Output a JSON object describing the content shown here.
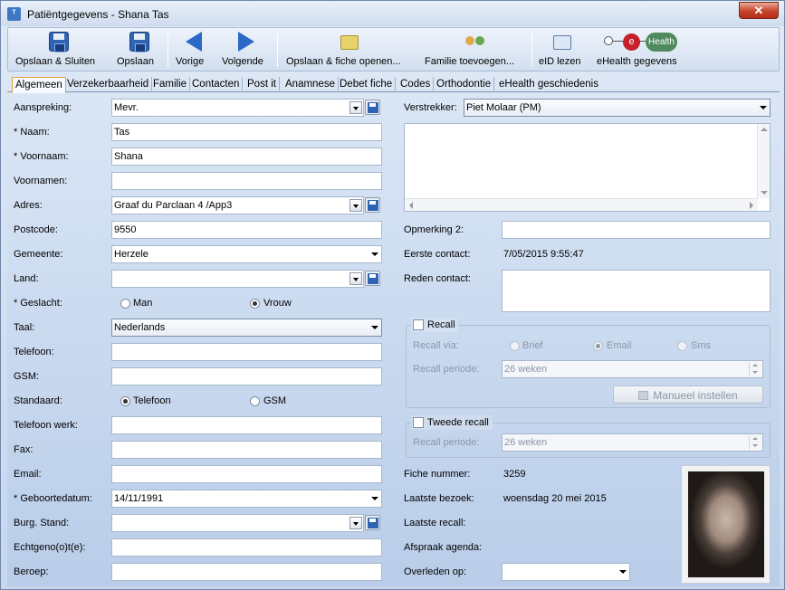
{
  "window": {
    "title": "Patiëntgegevens - Shana Tas",
    "close_label": "✕"
  },
  "toolbar": {
    "save_close": "Opslaan & Sluiten",
    "save": "Opslaan",
    "prev": "Vorige",
    "next": "Volgende",
    "save_open": "Opslaan & fiche openen...",
    "add_family": "Familie toevoegen...",
    "eid": "eID lezen",
    "ehealth": "eHealth gegevens",
    "ehealth_logo_e": "e",
    "ehealth_logo_text": "Health"
  },
  "tabs": [
    "Algemeen",
    "Verzekerbaarheid",
    "Familie",
    "Contacten",
    "Post it",
    "Anamnese",
    "Debet fiche",
    "Codes",
    "Orthodontie",
    "eHealth geschiedenis"
  ],
  "form": {
    "aanspreking_label": "Aanspreking:",
    "aanspreking_value": "Mevr.",
    "naam_label": "* Naam:",
    "naam_value": "Tas",
    "voornaam_label": "* Voornaam:",
    "voornaam_value": "Shana",
    "voornamen_label": "Voornamen:",
    "voornamen_value": "",
    "adres_label": "Adres:",
    "adres_value": "Graaf du Parclaan 4 /App3",
    "postcode_label": "Postcode:",
    "postcode_value": "9550",
    "gemeente_label": "Gemeente:",
    "gemeente_value": "Herzele",
    "land_label": "Land:",
    "land_value": "",
    "geslacht_label": "* Geslacht:",
    "geslacht_man": "Man",
    "geslacht_vrouw": "Vrouw",
    "taal_label": "Taal:",
    "taal_value": "Nederlands",
    "telefoon_label": "Telefoon:",
    "gsm_label": "GSM:",
    "standaard_label": "Standaard:",
    "standaard_telefoon": "Telefoon",
    "standaard_gsm": "GSM",
    "telefoon_werk_label": "Telefoon werk:",
    "fax_label": "Fax:",
    "email_label": "Email:",
    "geboortedatum_label": "* Geboortedatum:",
    "geboortedatum_value": "14/11/1991",
    "burg_stand_label": "Burg. Stand:",
    "echtgenote_label": "Echtgeno(o)t(e):",
    "beroep_label": "Beroep:"
  },
  "right": {
    "verstrekker_label": "Verstrekker:",
    "verstrekker_value": "Piet Molaar (PM)",
    "opmerking2_label": "Opmerking 2:",
    "eerste_contact_label": "Eerste contact:",
    "eerste_contact_value": "7/05/2015 9:55:47",
    "reden_contact_label": "Reden contact:",
    "recall_label": "Recall",
    "recall_via_label": "Recall via:",
    "recall_brief": "Brief",
    "recall_email": "Email",
    "recall_sms": "Sms",
    "recall_periode_label": "Recall periode:",
    "recall_periode_value": "26 weken",
    "manueel_label": "Manueel instellen",
    "tweede_recall_label": "Tweede recall",
    "tweede_periode_label": "Recall periode:",
    "tweede_periode_value": "26 weken",
    "fiche_nummer_label": "Fiche nummer:",
    "fiche_nummer_value": "3259",
    "laatste_bezoek_label": "Laatste bezoek:",
    "laatste_bezoek_value": "woensdag 20 mei 2015",
    "laatste_recall_label": "Laatste recall:",
    "afspraak_label": "Afspraak agenda:",
    "overleden_label": "Overleden op:"
  }
}
